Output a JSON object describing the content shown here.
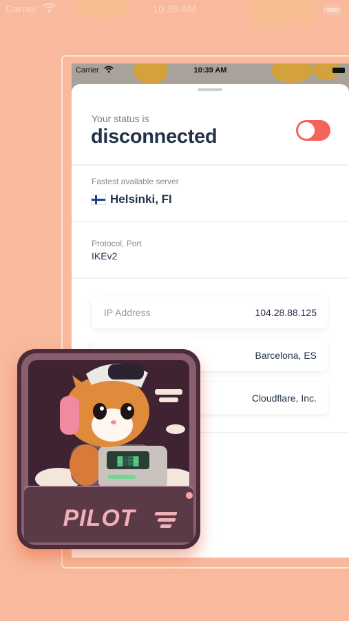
{
  "outer_status_bar": {
    "carrier": "Carrier",
    "time": "10:39 AM"
  },
  "phone": {
    "status_bar": {
      "carrier": "Carrier",
      "time": "10:39 AM"
    },
    "status": {
      "label": "Your status is",
      "value": "disconnected",
      "toggle_on": false
    },
    "server": {
      "label": "Fastest available server",
      "name": "Helsinki, FI",
      "flag": "finland-flag"
    },
    "protocol": {
      "label": "Protocol, Port",
      "value": "IKEv2"
    },
    "info_cards": [
      {
        "key": "IP Address",
        "value": "104.28.88.125"
      },
      {
        "key": "",
        "value": "Barcelona, ES"
      },
      {
        "key": "",
        "value": "Cloudflare, Inc."
      }
    ]
  },
  "logo": {
    "text": "PILOT",
    "icon": "cat-pilot-mascot"
  },
  "colors": {
    "accent": "#f3645a",
    "background": "#f8b99c",
    "text": "#23324a"
  }
}
